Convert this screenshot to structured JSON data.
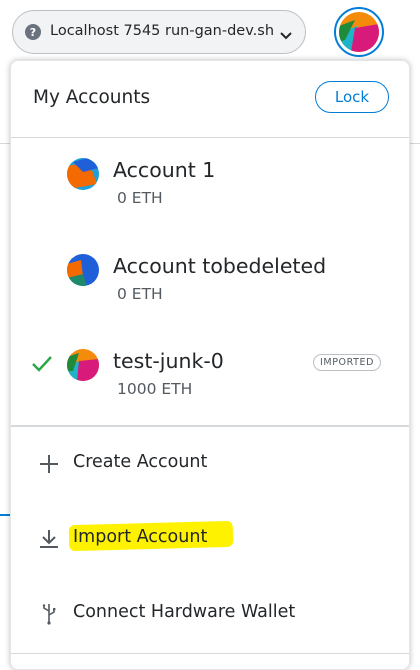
{
  "network": {
    "label": "Localhost 7545 run-gan-dev.sh",
    "icon": "question-icon"
  },
  "menu": {
    "title": "My Accounts",
    "lock_label": "Lock",
    "accounts": [
      {
        "name": "Account 1",
        "balance": "0 ETH",
        "selected": false,
        "imported": false
      },
      {
        "name": "Account tobedeleted",
        "balance": "0 ETH",
        "selected": false,
        "imported": false
      },
      {
        "name": "test-junk-0",
        "balance": "1000 ETH",
        "selected": true,
        "imported": true,
        "badge": "IMPORTED"
      }
    ],
    "actions": {
      "create": "Create Account",
      "import": "Import Account",
      "hardware": "Connect Hardware Wallet"
    }
  },
  "colors": {
    "accent": "#037dd6",
    "check": "#28a745",
    "highlight": "#fff200"
  }
}
